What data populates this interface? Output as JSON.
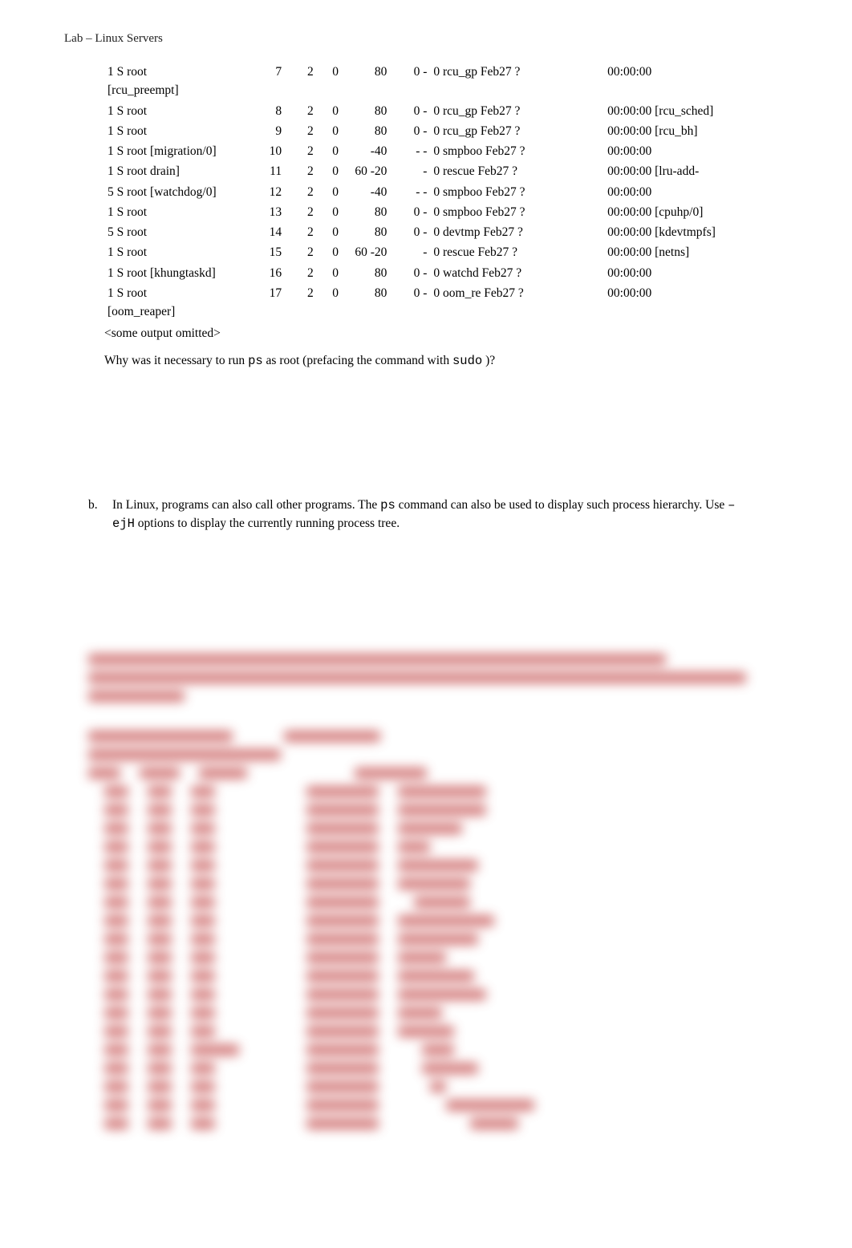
{
  "header": "Lab – Linux Servers",
  "ps_rows": [
    {
      "a": "1 S root [rcu_preempt]",
      "b": "7",
      "c": "2",
      "d": "0",
      "e": "80",
      "f": "0 -",
      "g": "0 rcu_gp Feb27 ?",
      "h": "00:00:00"
    },
    {
      "a": "1 S root",
      "b": "8",
      "c": "2",
      "d": "0",
      "e": "80",
      "f": "0 -",
      "g": "0 rcu_gp Feb27 ?",
      "h": "00:00:00 [rcu_sched]"
    },
    {
      "a": "1 S root",
      "b": "9",
      "c": "2",
      "d": "0",
      "e": "80",
      "f": "0 -",
      "g": "0 rcu_gp Feb27 ?",
      "h": "00:00:00 [rcu_bh]"
    },
    {
      "a": "1 S root [migration/0]",
      "b": "10",
      "c": "2",
      "d": "0",
      "e": "-40",
      "f": "- -",
      "g": "0 smpboo Feb27 ?",
      "h": "00:00:00"
    },
    {
      "a": "1 S root drain]",
      "b": "11",
      "c": "2",
      "d": "0",
      "e": "60 -20",
      "f": "-",
      "g": "0 rescue Feb27 ?",
      "h": "00:00:00 [lru-add-"
    },
    {
      "a": "5 S root [watchdog/0]",
      "b": "12",
      "c": "2",
      "d": "0",
      "e": "-40",
      "f": "- -",
      "g": "0 smpboo Feb27 ?",
      "h": "00:00:00"
    },
    {
      "a": "1 S root",
      "b": "13",
      "c": "2",
      "d": "0",
      "e": "80",
      "f": "0 -",
      "g": "0 smpboo Feb27 ?",
      "h": "00:00:00 [cpuhp/0]"
    },
    {
      "a": "5 S root",
      "b": "14",
      "c": "2",
      "d": "0",
      "e": "80",
      "f": "0 -",
      "g": "0 devtmp Feb27 ?",
      "h": "00:00:00 [kdevtmpfs]"
    },
    {
      "a": "1 S root",
      "b": "15",
      "c": "2",
      "d": "0",
      "e": "60 -20",
      "f": "-",
      "g": "0 rescue Feb27 ?",
      "h": "00:00:00 [netns]"
    },
    {
      "a": "1 S root [khungtaskd]",
      "b": "16",
      "c": "2",
      "d": "0",
      "e": "80",
      "f": "0 -",
      "g": "0 watchd Feb27 ?",
      "h": "00:00:00"
    },
    {
      "a": "1 S root [oom_reaper]",
      "b": "17",
      "c": "2",
      "d": "0",
      "e": "80",
      "f": "0 -",
      "g": "0 oom_re Feb27 ?",
      "h": "00:00:00"
    }
  ],
  "omitted": "<some output omitted>",
  "question": {
    "prefix": "Why was it necessary to run ",
    "cmd1": "ps",
    "mid": " as root (prefacing the command with ",
    "cmd2": "sudo",
    "suffix": " )?"
  },
  "item_b": {
    "marker": "b.",
    "text_parts": [
      "In Linux, programs can also call other programs. The ",
      "ps",
      " command can also be used to display such process hierarchy. Use ",
      "–ejH",
      " options to display the currently running process tree."
    ]
  }
}
